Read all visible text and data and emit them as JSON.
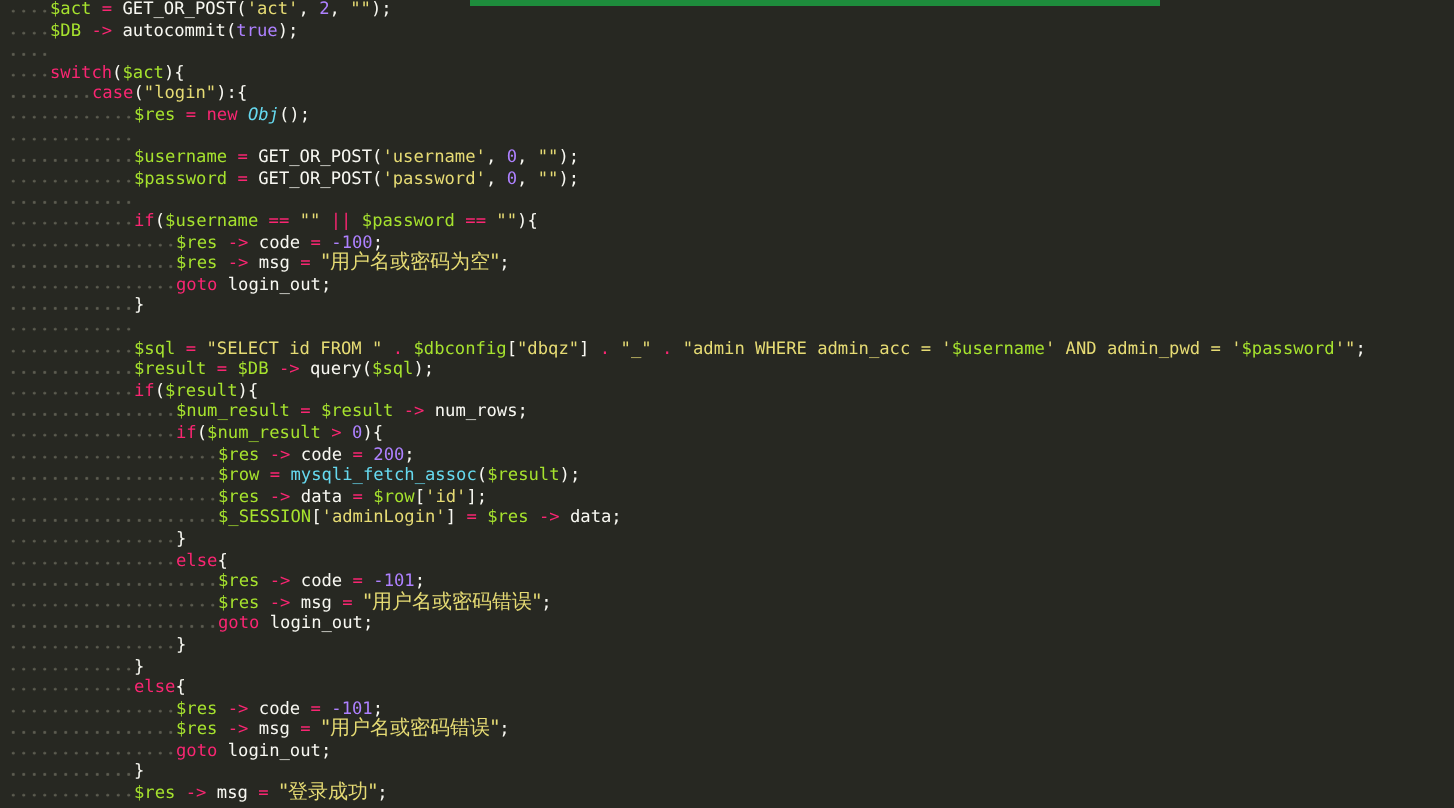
{
  "editor": {
    "lines": [
      {
        "kind": "code",
        "tokens": [
          {
            "kind": "var",
            "text": "$act"
          },
          {
            "kind": "op",
            "text": " = "
          },
          {
            "kind": "txt",
            "text": "GET_OR_POST("
          },
          {
            "kind": "str",
            "text": "'act'"
          },
          {
            "kind": "txt",
            "text": ", "
          },
          {
            "kind": "num",
            "text": "2"
          },
          {
            "kind": "txt",
            "text": ", "
          },
          {
            "kind": "str",
            "text": "\"\""
          },
          {
            "kind": "txt",
            "text": ");"
          }
        ]
      },
      {
        "kind": "code",
        "tokens": [
          {
            "kind": "var",
            "text": "$DB"
          },
          {
            "kind": "op",
            "text": " -> "
          },
          {
            "kind": "txt",
            "text": "autocommit("
          },
          {
            "kind": "num",
            "text": "true"
          },
          {
            "kind": "txt",
            "text": ");"
          }
        ]
      },
      {
        "kind": "blank"
      },
      {
        "kind": "code",
        "tokens": [
          {
            "kind": "kw",
            "text": "switch"
          },
          {
            "kind": "txt",
            "text": "("
          },
          {
            "kind": "var",
            "text": "$act"
          },
          {
            "kind": "txt",
            "text": "){"
          }
        ],
        "children": [
          {
            "kind": "code",
            "tokens": [
              {
                "kind": "kw",
                "text": "case"
              },
              {
                "kind": "txt",
                "text": "("
              },
              {
                "kind": "str",
                "text": "\"login\""
              },
              {
                "kind": "txt",
                "text": "):{"
              }
            ],
            "children": [
              {
                "kind": "code",
                "tokens": [
                  {
                    "kind": "var",
                    "text": "$res"
                  },
                  {
                    "kind": "op",
                    "text": " = "
                  },
                  {
                    "kind": "kw",
                    "text": "new "
                  },
                  {
                    "kind": "cls",
                    "text": "Obj"
                  },
                  {
                    "kind": "txt",
                    "text": "();"
                  }
                ]
              },
              {
                "kind": "blank"
              },
              {
                "kind": "code",
                "tokens": [
                  {
                    "kind": "var",
                    "text": "$username"
                  },
                  {
                    "kind": "op",
                    "text": " = "
                  },
                  {
                    "kind": "txt",
                    "text": "GET_OR_POST("
                  },
                  {
                    "kind": "str",
                    "text": "'username'"
                  },
                  {
                    "kind": "txt",
                    "text": ", "
                  },
                  {
                    "kind": "num",
                    "text": "0"
                  },
                  {
                    "kind": "txt",
                    "text": ", "
                  },
                  {
                    "kind": "str",
                    "text": "\"\""
                  },
                  {
                    "kind": "txt",
                    "text": ");"
                  }
                ]
              },
              {
                "kind": "code",
                "tokens": [
                  {
                    "kind": "var",
                    "text": "$password"
                  },
                  {
                    "kind": "op",
                    "text": " = "
                  },
                  {
                    "kind": "txt",
                    "text": "GET_OR_POST("
                  },
                  {
                    "kind": "str",
                    "text": "'password'"
                  },
                  {
                    "kind": "txt",
                    "text": ", "
                  },
                  {
                    "kind": "num",
                    "text": "0"
                  },
                  {
                    "kind": "txt",
                    "text": ", "
                  },
                  {
                    "kind": "str",
                    "text": "\"\""
                  },
                  {
                    "kind": "txt",
                    "text": ");"
                  }
                ]
              },
              {
                "kind": "blank"
              },
              {
                "kind": "code",
                "tokens": [
                  {
                    "kind": "kw",
                    "text": "if"
                  },
                  {
                    "kind": "txt",
                    "text": "("
                  },
                  {
                    "kind": "var",
                    "text": "$username"
                  },
                  {
                    "kind": "op",
                    "text": " == "
                  },
                  {
                    "kind": "str",
                    "text": "\"\""
                  },
                  {
                    "kind": "op",
                    "text": " || "
                  },
                  {
                    "kind": "var",
                    "text": "$password"
                  },
                  {
                    "kind": "op",
                    "text": " == "
                  },
                  {
                    "kind": "str",
                    "text": "\"\""
                  },
                  {
                    "kind": "txt",
                    "text": "){"
                  }
                ],
                "children": [
                  {
                    "kind": "code",
                    "tokens": [
                      {
                        "kind": "var",
                        "text": "$res"
                      },
                      {
                        "kind": "op",
                        "text": " -> "
                      },
                      {
                        "kind": "txt",
                        "text": "code"
                      },
                      {
                        "kind": "op",
                        "text": " = "
                      },
                      {
                        "kind": "num",
                        "text": "-100"
                      },
                      {
                        "kind": "txt",
                        "text": ";"
                      }
                    ]
                  },
                  {
                    "kind": "code",
                    "tokens": [
                      {
                        "kind": "var",
                        "text": "$res"
                      },
                      {
                        "kind": "op",
                        "text": " -> "
                      },
                      {
                        "kind": "txt",
                        "text": "msg"
                      },
                      {
                        "kind": "op",
                        "text": " = "
                      },
                      {
                        "kind": "cjk",
                        "text": "\"用户名或密码为空\""
                      },
                      {
                        "kind": "txt",
                        "text": ";"
                      }
                    ]
                  },
                  {
                    "kind": "code",
                    "tokens": [
                      {
                        "kind": "kw",
                        "text": "goto"
                      },
                      {
                        "kind": "txt",
                        "text": " login_out;"
                      }
                    ]
                  }
                ]
              },
              {
                "kind": "code",
                "tokens": [
                  {
                    "kind": "txt",
                    "text": "}"
                  }
                ]
              },
              {
                "kind": "blank"
              },
              {
                "kind": "code",
                "tokens": [
                  {
                    "kind": "var",
                    "text": "$sql"
                  },
                  {
                    "kind": "op",
                    "text": " = "
                  },
                  {
                    "kind": "str",
                    "text": "\"SELECT id FROM \""
                  },
                  {
                    "kind": "op",
                    "text": " . "
                  },
                  {
                    "kind": "var",
                    "text": "$dbconfig"
                  },
                  {
                    "kind": "txt",
                    "text": "["
                  },
                  {
                    "kind": "str",
                    "text": "\"dbqz\""
                  },
                  {
                    "kind": "txt",
                    "text": "]"
                  },
                  {
                    "kind": "op",
                    "text": " . "
                  },
                  {
                    "kind": "str",
                    "text": "\"_\""
                  },
                  {
                    "kind": "op",
                    "text": " . "
                  },
                  {
                    "kind": "str",
                    "text": "\"admin WHERE admin_acc = '"
                  },
                  {
                    "kind": "var",
                    "text": "$username"
                  },
                  {
                    "kind": "str",
                    "text": "' AND admin_pwd = '"
                  },
                  {
                    "kind": "var",
                    "text": "$password"
                  },
                  {
                    "kind": "str",
                    "text": "'\""
                  },
                  {
                    "kind": "txt",
                    "text": ";"
                  }
                ]
              },
              {
                "kind": "code",
                "tokens": [
                  {
                    "kind": "var",
                    "text": "$result"
                  },
                  {
                    "kind": "op",
                    "text": " = "
                  },
                  {
                    "kind": "var",
                    "text": "$DB"
                  },
                  {
                    "kind": "op",
                    "text": " -> "
                  },
                  {
                    "kind": "txt",
                    "text": "query("
                  },
                  {
                    "kind": "var",
                    "text": "$sql"
                  },
                  {
                    "kind": "txt",
                    "text": ");"
                  }
                ]
              },
              {
                "kind": "code",
                "tokens": [
                  {
                    "kind": "kw",
                    "text": "if"
                  },
                  {
                    "kind": "txt",
                    "text": "("
                  },
                  {
                    "kind": "var",
                    "text": "$result"
                  },
                  {
                    "kind": "txt",
                    "text": "){"
                  }
                ],
                "children": [
                  {
                    "kind": "code",
                    "tokens": [
                      {
                        "kind": "var",
                        "text": "$num_result"
                      },
                      {
                        "kind": "op",
                        "text": " = "
                      },
                      {
                        "kind": "var",
                        "text": "$result"
                      },
                      {
                        "kind": "op",
                        "text": " -> "
                      },
                      {
                        "kind": "txt",
                        "text": "num_rows;"
                      }
                    ]
                  },
                  {
                    "kind": "code",
                    "tokens": [
                      {
                        "kind": "kw",
                        "text": "if"
                      },
                      {
                        "kind": "txt",
                        "text": "("
                      },
                      {
                        "kind": "var",
                        "text": "$num_result"
                      },
                      {
                        "kind": "op",
                        "text": " > "
                      },
                      {
                        "kind": "num",
                        "text": "0"
                      },
                      {
                        "kind": "txt",
                        "text": "){"
                      }
                    ],
                    "children": [
                      {
                        "kind": "code",
                        "tokens": [
                          {
                            "kind": "var",
                            "text": "$res"
                          },
                          {
                            "kind": "op",
                            "text": " -> "
                          },
                          {
                            "kind": "txt",
                            "text": "code"
                          },
                          {
                            "kind": "op",
                            "text": " = "
                          },
                          {
                            "kind": "num",
                            "text": "200"
                          },
                          {
                            "kind": "txt",
                            "text": ";"
                          }
                        ]
                      },
                      {
                        "kind": "code",
                        "tokens": [
                          {
                            "kind": "var",
                            "text": "$row"
                          },
                          {
                            "kind": "op",
                            "text": " = "
                          },
                          {
                            "kind": "fn",
                            "text": "mysqli_fetch_assoc"
                          },
                          {
                            "kind": "txt",
                            "text": "("
                          },
                          {
                            "kind": "var",
                            "text": "$result"
                          },
                          {
                            "kind": "txt",
                            "text": ");"
                          }
                        ]
                      },
                      {
                        "kind": "code",
                        "tokens": [
                          {
                            "kind": "var",
                            "text": "$res"
                          },
                          {
                            "kind": "op",
                            "text": " -> "
                          },
                          {
                            "kind": "txt",
                            "text": "data"
                          },
                          {
                            "kind": "op",
                            "text": " = "
                          },
                          {
                            "kind": "var",
                            "text": "$row"
                          },
                          {
                            "kind": "txt",
                            "text": "["
                          },
                          {
                            "kind": "str",
                            "text": "'id'"
                          },
                          {
                            "kind": "txt",
                            "text": "];"
                          }
                        ]
                      },
                      {
                        "kind": "code",
                        "tokens": [
                          {
                            "kind": "var",
                            "text": "$_SESSION"
                          },
                          {
                            "kind": "txt",
                            "text": "["
                          },
                          {
                            "kind": "str",
                            "text": "'adminLogin'"
                          },
                          {
                            "kind": "txt",
                            "text": "]"
                          },
                          {
                            "kind": "op",
                            "text": " = "
                          },
                          {
                            "kind": "var",
                            "text": "$res"
                          },
                          {
                            "kind": "op",
                            "text": " -> "
                          },
                          {
                            "kind": "txt",
                            "text": "data;"
                          }
                        ]
                      }
                    ]
                  },
                  {
                    "kind": "code",
                    "tokens": [
                      {
                        "kind": "txt",
                        "text": "}"
                      }
                    ]
                  },
                  {
                    "kind": "code",
                    "tokens": [
                      {
                        "kind": "kw",
                        "text": "else"
                      },
                      {
                        "kind": "txt",
                        "text": "{"
                      }
                    ],
                    "children": [
                      {
                        "kind": "code",
                        "tokens": [
                          {
                            "kind": "var",
                            "text": "$res"
                          },
                          {
                            "kind": "op",
                            "text": " -> "
                          },
                          {
                            "kind": "txt",
                            "text": "code"
                          },
                          {
                            "kind": "op",
                            "text": " = "
                          },
                          {
                            "kind": "num",
                            "text": "-101"
                          },
                          {
                            "kind": "txt",
                            "text": ";"
                          }
                        ]
                      },
                      {
                        "kind": "code",
                        "tokens": [
                          {
                            "kind": "var",
                            "text": "$res"
                          },
                          {
                            "kind": "op",
                            "text": " -> "
                          },
                          {
                            "kind": "txt",
                            "text": "msg"
                          },
                          {
                            "kind": "op",
                            "text": " = "
                          },
                          {
                            "kind": "cjk",
                            "text": "\"用户名或密码错误\""
                          },
                          {
                            "kind": "txt",
                            "text": ";"
                          }
                        ]
                      },
                      {
                        "kind": "code",
                        "tokens": [
                          {
                            "kind": "kw",
                            "text": "goto"
                          },
                          {
                            "kind": "txt",
                            "text": " login_out;"
                          }
                        ]
                      }
                    ]
                  },
                  {
                    "kind": "code",
                    "tokens": [
                      {
                        "kind": "txt",
                        "text": "}"
                      }
                    ]
                  }
                ]
              },
              {
                "kind": "code",
                "tokens": [
                  {
                    "kind": "txt",
                    "text": "}"
                  }
                ]
              },
              {
                "kind": "code",
                "tokens": [
                  {
                    "kind": "kw",
                    "text": "else"
                  },
                  {
                    "kind": "txt",
                    "text": "{"
                  }
                ],
                "children": [
                  {
                    "kind": "code",
                    "tokens": [
                      {
                        "kind": "var",
                        "text": "$res"
                      },
                      {
                        "kind": "op",
                        "text": " -> "
                      },
                      {
                        "kind": "txt",
                        "text": "code"
                      },
                      {
                        "kind": "op",
                        "text": " = "
                      },
                      {
                        "kind": "num",
                        "text": "-101"
                      },
                      {
                        "kind": "txt",
                        "text": ";"
                      }
                    ]
                  },
                  {
                    "kind": "code",
                    "tokens": [
                      {
                        "kind": "var",
                        "text": "$res"
                      },
                      {
                        "kind": "op",
                        "text": " -> "
                      },
                      {
                        "kind": "txt",
                        "text": "msg"
                      },
                      {
                        "kind": "op",
                        "text": " = "
                      },
                      {
                        "kind": "cjk",
                        "text": "\"用户名或密码错误\""
                      },
                      {
                        "kind": "txt",
                        "text": ";"
                      }
                    ]
                  },
                  {
                    "kind": "code",
                    "tokens": [
                      {
                        "kind": "kw",
                        "text": "goto"
                      },
                      {
                        "kind": "txt",
                        "text": " login_out;"
                      }
                    ]
                  }
                ]
              },
              {
                "kind": "code",
                "tokens": [
                  {
                    "kind": "txt",
                    "text": "}"
                  }
                ]
              },
              {
                "kind": "code",
                "tokens": [
                  {
                    "kind": "var",
                    "text": "$res"
                  },
                  {
                    "kind": "op",
                    "text": " -> "
                  },
                  {
                    "kind": "txt",
                    "text": "msg"
                  },
                  {
                    "kind": "op",
                    "text": " = "
                  },
                  {
                    "kind": "cjk",
                    "text": "\"登录成功\""
                  },
                  {
                    "kind": "txt",
                    "text": ";"
                  }
                ]
              }
            ]
          }
        ]
      }
    ]
  }
}
